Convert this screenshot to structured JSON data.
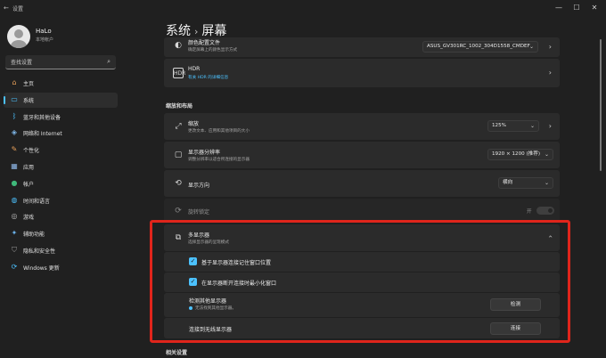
{
  "window": {
    "app_title": "设置",
    "controls": {
      "minimize": "—",
      "maximize": "☐",
      "close": "✕"
    }
  },
  "user": {
    "name": "HaLo",
    "subtitle": "本地帐户"
  },
  "search": {
    "placeholder": "查找设置",
    "icon": "search-icon"
  },
  "nav": {
    "items": [
      {
        "label": "主页",
        "icon": "home-icon",
        "color": "#e8a05a"
      },
      {
        "label": "系统",
        "icon": "system-icon",
        "color": "#4cc2ff",
        "active": true
      },
      {
        "label": "蓝牙和其他设备",
        "icon": "bluetooth-icon",
        "color": "#4cc2ff"
      },
      {
        "label": "网络和 Internet",
        "icon": "network-icon",
        "color": "#7fb7e8"
      },
      {
        "label": "个性化",
        "icon": "brush-icon",
        "color": "#e8a05a"
      },
      {
        "label": "应用",
        "icon": "apps-icon",
        "color": "#8fb8e8"
      },
      {
        "label": "帐户",
        "icon": "account-icon",
        "color": "#3fb87a"
      },
      {
        "label": "时间和语言",
        "icon": "globe-clock-icon",
        "color": "#4cc2ff"
      },
      {
        "label": "游戏",
        "icon": "gamepad-icon",
        "color": "#b8b8b8"
      },
      {
        "label": "辅助功能",
        "icon": "accessibility-icon",
        "color": "#6ab0e8"
      },
      {
        "label": "隐私和安全性",
        "icon": "shield-icon",
        "color": "#9a9a9a"
      },
      {
        "label": "Windows 更新",
        "icon": "update-icon",
        "color": "#4cc2ff"
      }
    ]
  },
  "header": {
    "section": "系统",
    "page": "屏幕"
  },
  "cards": {
    "color_profile": {
      "title": "颜色配置文件",
      "subtitle": "确定屏幕上的颜色显示方式",
      "value": "ASUS_GV301RC_1002_304D1558_CMDEF"
    },
    "hdr": {
      "title": "HDR",
      "link": "有关 HDR 的详细信息"
    },
    "section_label": "缩放和布局",
    "scale": {
      "title": "缩放",
      "subtitle": "更改文本、应用和其他项目的大小",
      "value": "125%"
    },
    "resolution": {
      "title": "显示器分辨率",
      "subtitle": "调整分辨率以适合所连接的显示器",
      "value": "1920 × 1200 (推荐)"
    },
    "orientation": {
      "title": "显示方向",
      "value": "横向"
    },
    "rotation_lock": {
      "title": "旋转锁定",
      "state": "开"
    },
    "multi": {
      "title": "多显示器",
      "subtitle": "选择显示器的呈现模式",
      "check1": "基于显示器连接记住窗口位置",
      "check2": "在显示器断开连接时最小化窗口",
      "detect_title": "检测其他显示器",
      "detect_sub": "无法找到其他显示器。",
      "detect_button": "检测",
      "wireless_title": "连接到无线显示器",
      "connect_button": "连接"
    },
    "related": "相关设置"
  }
}
